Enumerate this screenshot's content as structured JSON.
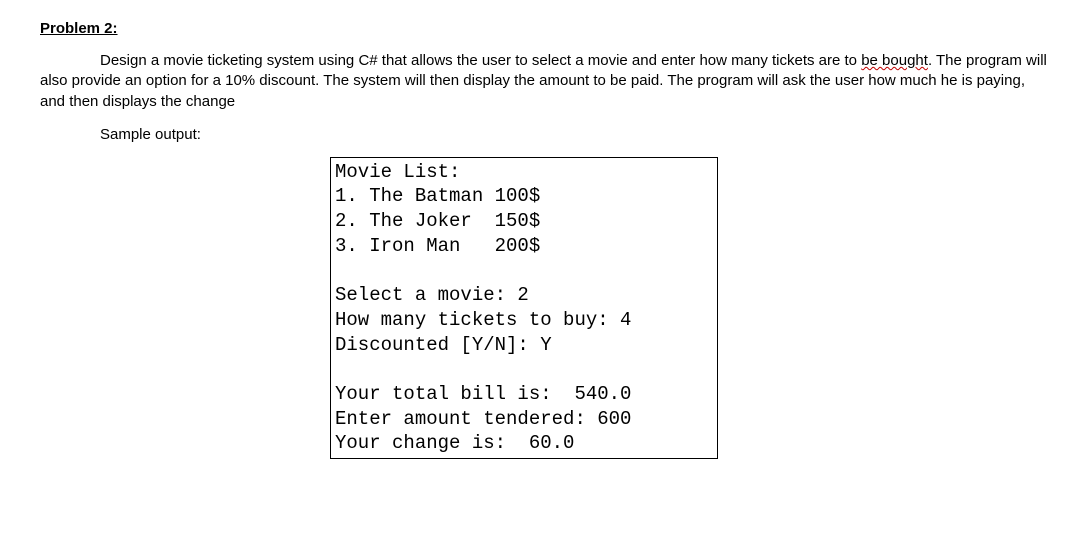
{
  "title": "Problem 2:",
  "desc_part1": "Design a movie ticketing system using C# that allows the user to select a movie and enter how many tickets are to ",
  "desc_squiggly": "be bought",
  "desc_part2": ". The program will also provide an option for a 10% discount. The system will then display the amount to be paid. The program will ask the user how much he is paying, and then displays the change",
  "sample_label": "Sample output:",
  "output": {
    "l1": "Movie List:",
    "l2": "1. The Batman 100$",
    "l3": "2. The Joker  150$",
    "l4": "3. Iron Man   200$",
    "l5": "",
    "l6": "Select a movie: 2",
    "l7": "How many tickets to buy: 4",
    "l8": "Discounted [Y/N]: Y",
    "l9": "",
    "l10": "Your total bill is:  540.0",
    "l11": "Enter amount tendered: 600",
    "l12": "Your change is:  60.0"
  }
}
